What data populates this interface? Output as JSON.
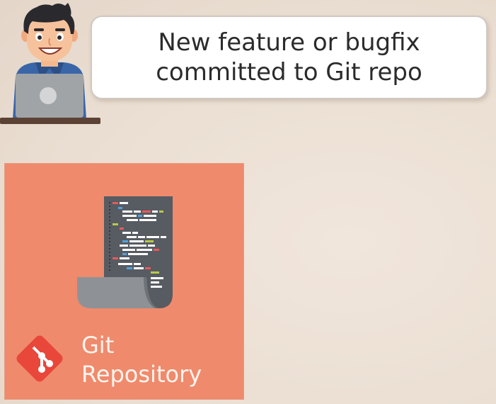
{
  "speech_bubble": {
    "line1": "New feature or bugfix",
    "line2": "committed to Git repo"
  },
  "repository": {
    "label_line1": "Git",
    "label_line2": "Repository"
  },
  "icons": {
    "developer": "developer-with-laptop-icon",
    "code": "code-document-icon",
    "git": "git-logo-icon"
  },
  "colors": {
    "background": "#ebdfd3",
    "repo_card": "#ef8a6c",
    "git_logo": "#e8473a",
    "document": "#575b62",
    "laptop": "#a0a4a7",
    "text_dark": "#2b2b2b",
    "text_light": "#fff4ee"
  }
}
